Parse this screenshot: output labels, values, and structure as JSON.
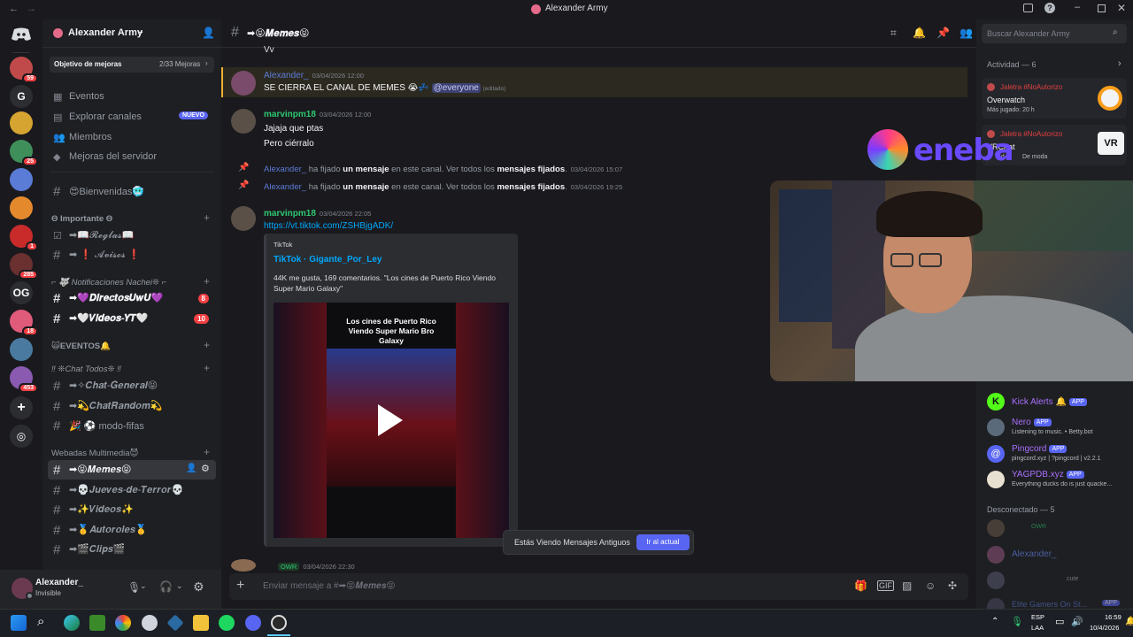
{
  "window": {
    "title": "Alexander Army"
  },
  "server": {
    "name": "Alexander Army",
    "boost_label": "Objetivo de mejoras",
    "boost_count": "2/33 Mejoras"
  },
  "server_badges": [
    "59",
    "25",
    "1",
    "285",
    "18",
    "453"
  ],
  "server_letters": [
    "G",
    "OG"
  ],
  "nav": {
    "events": "Eventos",
    "explore": "Explorar canales",
    "explore_badge": "NUEVO",
    "members": "Miembros",
    "boosts": "Mejoras del servidor"
  },
  "channels": {
    "welcome": "😍Bienvenidas🥶",
    "cat_important": "Θ Importante Θ",
    "rules": "➡📖𝓡𝓮𝓰𝓵𝓪𝓼📖",
    "notices": "➡ ❗ 𝓐𝓿𝓲𝓼𝓸𝓼 ❗",
    "cat_notif": "⌐ 🐺 Notificaciones Nachei❊ ⌐",
    "directos": "➡💜𝑫𝒊𝒓𝒆𝒄𝒕𝒐𝒔𝑼𝒘𝑼💜",
    "directos_badge": "8",
    "videos_yt": "➡🤍𝑽𝒊𝒅𝒆𝒐𝒔-𝒀𝑻🤍",
    "videos_yt_badge": "10",
    "cat_events": "🙀EVENTOS🔔",
    "cat_chat": "‼ ❊Chat Todos❊ ‼",
    "general": "➡✧𝑪𝒉𝒂𝒕-𝑮𝒆𝒏𝒆𝒓𝒂𝒍😝",
    "random": "➡💫𝑪𝒉𝒂𝒕𝑹𝒂𝒏𝒅𝒐𝒎💫",
    "fifas": "🎉 ⚽ modo-fifas",
    "cat_media": "Webadas Multimedia😈",
    "memes": "➡😝𝑴𝒆𝒎𝒆𝒔😝",
    "jueves": "➡💀𝑱𝒖𝒆𝒗𝒆𝒔-𝒅𝒆-𝑻𝒆𝒓𝒓𝒐𝒓💀",
    "videos": "➡✨𝑽𝒊𝒅𝒆𝒐𝒔✨",
    "autoroles": "➡🥇𝑨𝒖𝒕𝒐𝒓𝒐𝒍𝒆𝒔🥇",
    "clips": "➡🎬𝑪𝒍𝒊𝒑𝒔🎬"
  },
  "user": {
    "name": "Alexander_",
    "status": "Invisible"
  },
  "header": {
    "channel": "➡😝𝑴𝒆𝒎𝒆𝒔😝",
    "search_placeholder": "Buscar Alexander Army"
  },
  "messages": {
    "prev": "Vv",
    "m1_author": "Alexander_",
    "m1_time": "03/04/2026 12:00",
    "m1_text": "SE CIERRA EL CANAL DE MEMES 😭💤",
    "m1_mention": "@everyone",
    "m1_edited": "(editado)",
    "m2_author": "marvinpm18",
    "m2_time": "03/04/2026 12:00",
    "m2_line1": "Jajaja que ptas",
    "m2_line2": "Pero ciérralo",
    "pin1": {
      "user": "Alexander_",
      "a": " ha fijado ",
      "b": "un mensaje",
      "c": " en este canal. Ver todos los ",
      "d": "mensajes fijados",
      "e": ".",
      "time": "03/04/2026 15:07"
    },
    "pin2": {
      "user": "Alexander_",
      "a": " ha fijado ",
      "b": "un mensaje",
      "c": " en este canal. Ver todos los ",
      "d": "mensajes fijados",
      "e": ".",
      "time": "03/04/2026 19:25"
    },
    "m3_author": "marvinpm18",
    "m3_time": "03/04/2026 22:05",
    "m3_link": "https://vt.tiktok.com/ZSHBjgADK/",
    "embed": {
      "provider": "TikTok",
      "title": "TikTok · Gigante_Por_Ley",
      "desc": "44K me gusta, 169 comentarios. \"Los cines de Puerto Rico Viendo Super Mario Galaxy\"",
      "video_caption": "Los cines de Puerto Rico Viendo Super Mario Bro Galaxy"
    },
    "m4_tag": "OWR",
    "m4_time": "03/04/2026 22:30"
  },
  "old_banner": {
    "text": "Estás Viendo Mensajes Antiguos",
    "button": "Ir al actual"
  },
  "composer": {
    "placeholder": "Enviar mensaje a #➡😝𝑴𝒆𝒎𝒆𝒔😝"
  },
  "activity": {
    "label": "Actividad — 6",
    "a1_user": "Jaletra #NoAutorizo",
    "a1_game": "Overwatch",
    "a1_meta": "Más jugado: 20 h",
    "a2_user": "Jaletra #NoAutorizo",
    "a2_game": "VRChat",
    "a2_meta": "3 d",
    "a2_trend": "De moda"
  },
  "overlay": {
    "brand": "eneba"
  },
  "member_list": {
    "bots": [
      {
        "name": "Kick Alerts 🔔",
        "tag": "APP",
        "status": ""
      },
      {
        "name": "Nero",
        "tag": "APP",
        "status": "Listening to music. • Betty.bot"
      },
      {
        "name": "Pingcord",
        "tag": "APP",
        "status": "pingcord.xyz | ?pingcord | v2.2.1"
      },
      {
        "name": "YAGPDB.xyz",
        "tag": "APP",
        "status": "Everything ducks do is just quacke..."
      }
    ],
    "offline_label": "Desconectado — 5",
    "offline": [
      "OWR",
      "Alexander_",
      "cute",
      "Elite Gamers On St...",
      "APP"
    ]
  },
  "taskbar": {
    "lang": "ESP",
    "region": "LAA",
    "time": "16:59",
    "date": "10/4/2026"
  },
  "colors": {
    "accent": "#5865f2",
    "green": "#23a55a",
    "red": "#f23f43",
    "bg": "#1a1a1e"
  }
}
